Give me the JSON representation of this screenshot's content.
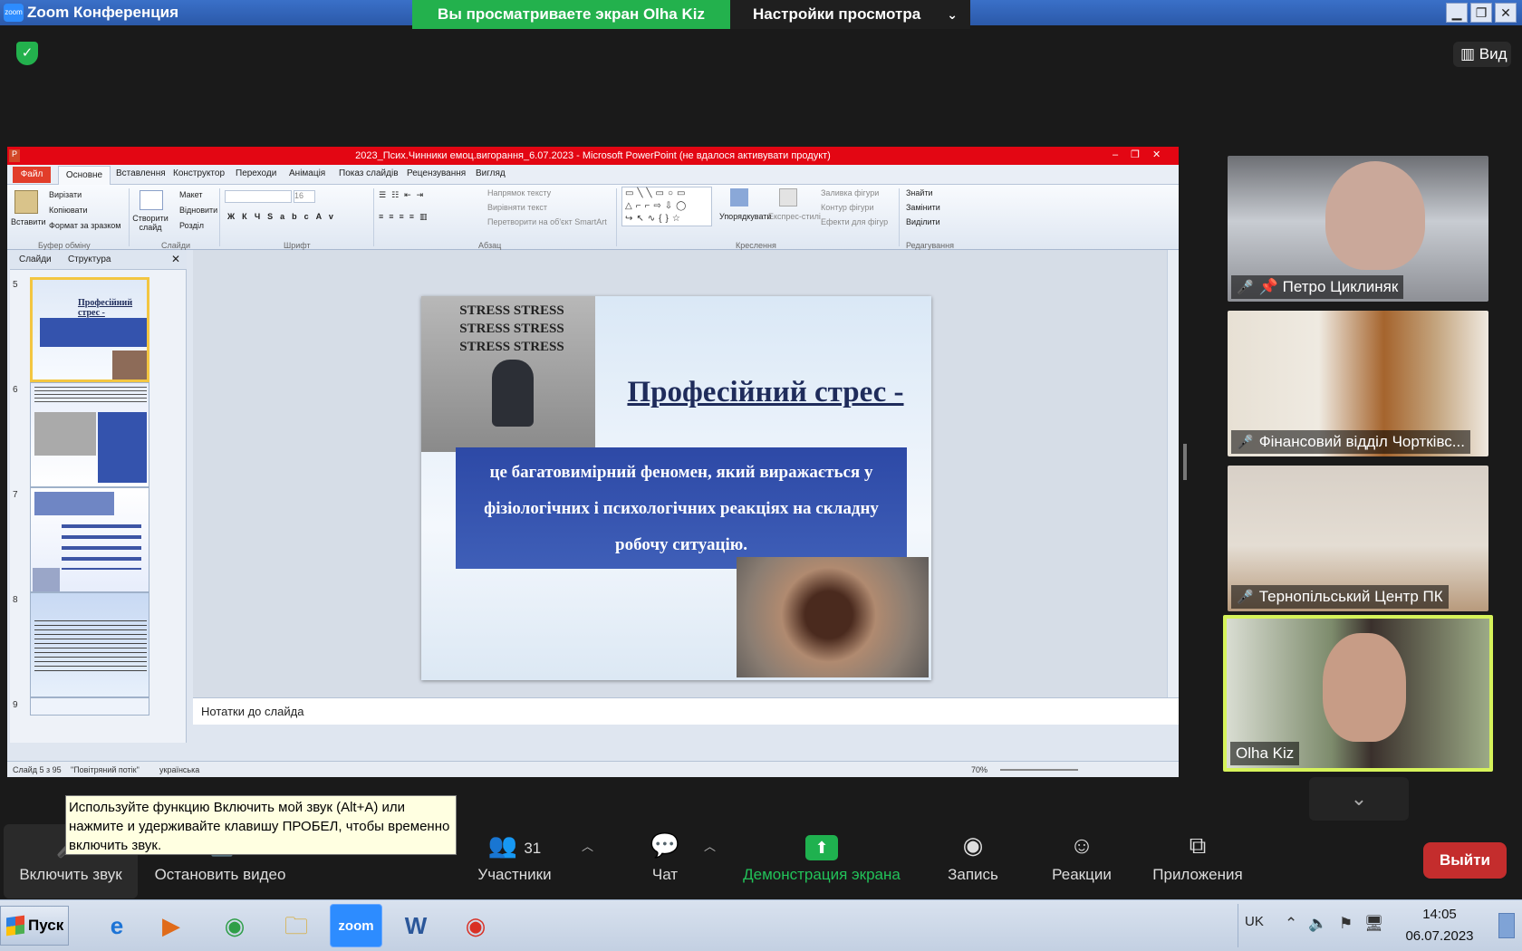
{
  "window": {
    "app_title": "Zoom Конференция",
    "minimize": "▁",
    "maximize": "❐",
    "close": "✕"
  },
  "share": {
    "banner": "Вы просматриваете экран Olha Kiz",
    "view_settings": "Настройки просмотра"
  },
  "top": {
    "view_label": "Вид"
  },
  "ppt": {
    "title": "2023_Псих.Чинники емоц.вигорання_6.07.2023 - Microsoft PowerPoint (не вдалося активувати продукт)",
    "tabs": [
      "Файл",
      "Основне",
      "Вставлення",
      "Конструктор",
      "Переходи",
      "Анімація",
      "Показ слайдів",
      "Рецензування",
      "Вигляд"
    ],
    "ribbon": {
      "paste": "Вставити",
      "cut": "Вирізати",
      "copy": "Копіювати",
      "format_painter": "Формат за зразком",
      "new_slide": "Створити слайд",
      "layout": "Макет",
      "reset": "Відновити",
      "section": "Розділ",
      "font_size": "16",
      "text_direction": "Напрямок тексту",
      "align_text": "Вирівняти текст",
      "smartart": "Перетворити на об'єкт SmartArt",
      "arrange": "Упорядкувати",
      "quick_styles": "Експрес-стилі",
      "shape_fill": "Заливка фігури",
      "shape_outline": "Контур фігури",
      "shape_effects": "Ефекти для фігур",
      "find": "Знайти",
      "replace": "Замінити",
      "select": "Виділити",
      "groups": [
        "Буфер обміну",
        "Слайди",
        "Шрифт",
        "Абзац",
        "Креслення",
        "Редагування"
      ]
    },
    "side_tabs": [
      "Слайди",
      "Структура"
    ],
    "thumbs": [
      {
        "num": "5",
        "title": "Професійний стрес -"
      },
      {
        "num": "6"
      },
      {
        "num": "7"
      },
      {
        "num": "8"
      },
      {
        "num": "9"
      }
    ],
    "slide": {
      "stress_words": "STRESS STRESS STRESS STRESS STRESS STRESS",
      "title": "Професійний стрес -",
      "body": "це багатовимірний феномен, який виражається у фізіологічних і психологічних реакціях на складну  робочу ситуацію."
    },
    "notes": "Нотатки до слайда",
    "status": {
      "slide": "Слайд 5 з 95",
      "theme": "\"Повітряний потік\"",
      "lang": "українська",
      "zoom": "70%"
    }
  },
  "participants": [
    {
      "name": "Петро Циклиняк",
      "muted": true,
      "pinned": true
    },
    {
      "name": "Фінансовий відділ Чортківс...",
      "muted": true
    },
    {
      "name": "Тернопільський Центр ПК",
      "muted": true
    },
    {
      "name": "Olha Kiz",
      "muted": false
    }
  ],
  "tooltip": "Используйте функцию Включить мой звук (Alt+A) или нажмите и удерживайте клавишу ПРОБЕЛ, чтобы временно включить звук.",
  "toolbar": {
    "unmute": "Включить звук",
    "stop_video": "Остановить видео",
    "participants": "Участники",
    "participants_count": "31",
    "chat": "Чат",
    "share_screen": "Демонстрация экрана",
    "record": "Запись",
    "reactions": "Реакции",
    "apps": "Приложения",
    "leave": "Выйти"
  },
  "taskbar": {
    "start": "Пуск",
    "lang": "UK",
    "time": "14:05",
    "date": "06.07.2023",
    "zoom_app": "zoom"
  }
}
